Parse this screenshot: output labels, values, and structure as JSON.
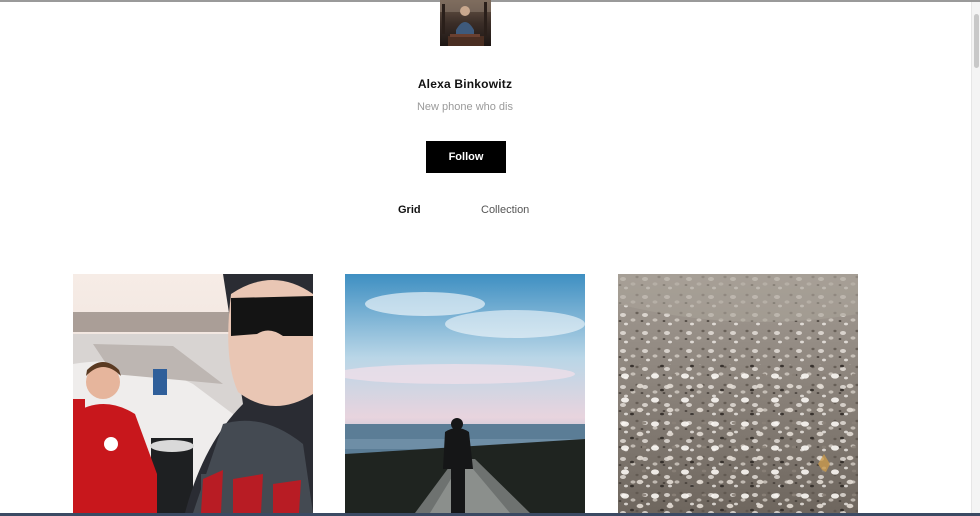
{
  "profile": {
    "name": "Alexa Binkowitz",
    "bio": "New phone who dis",
    "follow_label": "Follow"
  },
  "tabs": [
    {
      "label": "Grid",
      "active": true
    },
    {
      "label": "Collection",
      "active": false
    }
  ],
  "photos": [
    {
      "subject": "selfie with friend in red jacket on snowy beach"
    },
    {
      "subject": "silhouette on rocky jetty under blue sky"
    },
    {
      "subject": "close-up of seashells on sand"
    }
  ],
  "colors": {
    "follow_bg": "#000000",
    "bio_text": "#9a9a9a",
    "name_text": "#111111"
  }
}
